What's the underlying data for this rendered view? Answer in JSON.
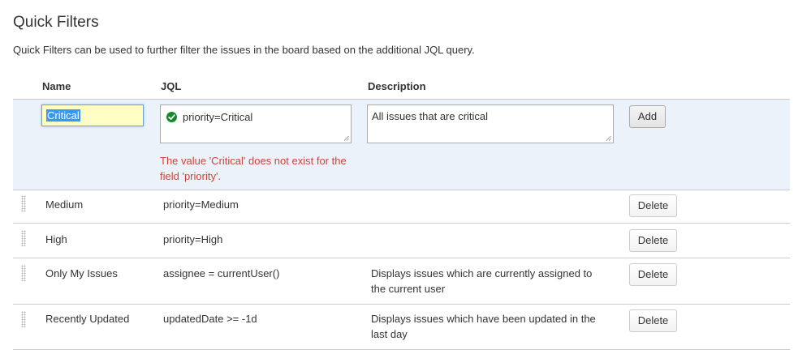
{
  "page": {
    "title": "Quick Filters",
    "description": "Quick Filters can be used to further filter the issues in the board based on the additional JQL query."
  },
  "table": {
    "headers": {
      "name": "Name",
      "jql": "JQL",
      "description": "Description"
    }
  },
  "new_filter": {
    "name_value": "Critical",
    "jql_value": "priority=Critical",
    "description_value": "All issues that are critical",
    "error": "The value 'Critical' does not exist for the field 'priority'.",
    "add_label": "Add",
    "jql_status_icon": "check-circle-icon",
    "jql_status_color": "#14892c",
    "error_color": "#d04437",
    "row_background": "#ebf2f9"
  },
  "filters": [
    {
      "name": "Medium",
      "jql": "priority=Medium",
      "description": "",
      "delete_label": "Delete"
    },
    {
      "name": "High",
      "jql": "priority=High",
      "description": "",
      "delete_label": "Delete"
    },
    {
      "name": "Only My Issues",
      "jql": "assignee = currentUser()",
      "description": "Displays issues which are currently assigned to the current user",
      "delete_label": "Delete"
    },
    {
      "name": "Recently Updated",
      "jql": "updatedDate >= -1d",
      "description": "Displays issues which have been updated in the last day",
      "delete_label": "Delete"
    }
  ]
}
